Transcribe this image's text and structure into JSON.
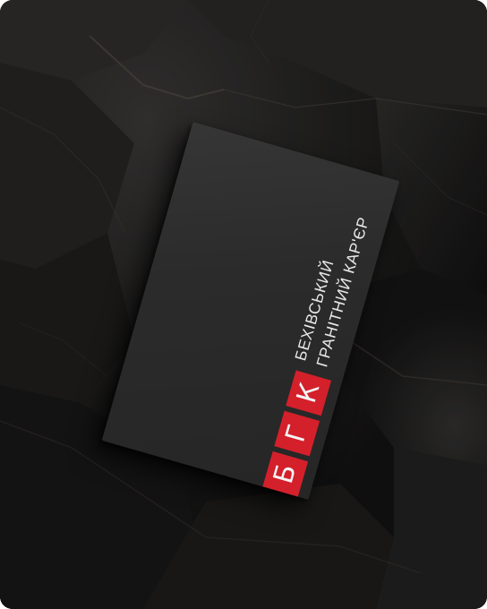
{
  "scene": {
    "description_colors": {
      "background": "#1b1a1a",
      "card": "#2b2b2b",
      "accent": "#d4202b",
      "text": "#e9e9e9"
    }
  },
  "card": {
    "logo_letters": [
      "Б",
      "Г",
      "К"
    ],
    "company_line_1": "БЕХІВСЬКИЙ",
    "company_line_2": "ГРАНІТНИЙ КАР'ЄР"
  }
}
